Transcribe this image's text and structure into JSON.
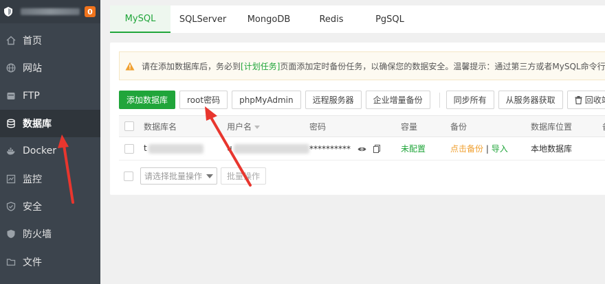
{
  "sidebar": {
    "badge": "0",
    "items": [
      {
        "label": "首页",
        "icon": "home-icon"
      },
      {
        "label": "网站",
        "icon": "globe-icon"
      },
      {
        "label": "FTP",
        "icon": "ftp-icon"
      },
      {
        "label": "数据库",
        "icon": "database-icon"
      },
      {
        "label": "Docker",
        "icon": "docker-icon"
      },
      {
        "label": "监控",
        "icon": "monitor-icon"
      },
      {
        "label": "安全",
        "icon": "shield-icon"
      },
      {
        "label": "防火墙",
        "icon": "firewall-icon"
      },
      {
        "label": "文件",
        "icon": "folder-icon"
      }
    ],
    "active_index": 3
  },
  "tabs": [
    "MySQL",
    "SQLServer",
    "MongoDB",
    "Redis",
    "PgSQL"
  ],
  "notice": {
    "text_before": "请在添加数据库后，务必到",
    "link": "[计划任务]",
    "text_after": "页面添加定时备份任务，以确保您的数据安全。温馨提示：通过第三方或者MySQL命令行创建的数据库需"
  },
  "toolbar": {
    "add_db": "添加数据库",
    "root_pwd": "root密码",
    "phpmyadmin": "phpMyAdmin",
    "remote_server": "远程服务器",
    "enterprise_backup": "企业增量备份",
    "sync_all": "同步所有",
    "fetch_from_server": "从服务器获取",
    "recycle_bin": "回收站"
  },
  "table": {
    "headers": {
      "name": "数据库名",
      "user": "用户名",
      "password": "密码",
      "capacity": "容量",
      "backup": "备份",
      "location": "数据库位置",
      "extra": "备"
    },
    "rows": [
      {
        "name_prefix": "t",
        "user_prefix": "u",
        "password": "**********",
        "capacity": "未配置",
        "backup_link": "点击备份",
        "backup_sep": " | ",
        "import_link": "导入",
        "location": "本地数据库"
      }
    ]
  },
  "batch": {
    "select_placeholder": "请选择批量操作",
    "button": "批量操作"
  },
  "colors": {
    "accent": "#20a53a",
    "arrow": "#e8362e",
    "sidebar_bg": "#3c444d",
    "badge": "#f0731c"
  }
}
